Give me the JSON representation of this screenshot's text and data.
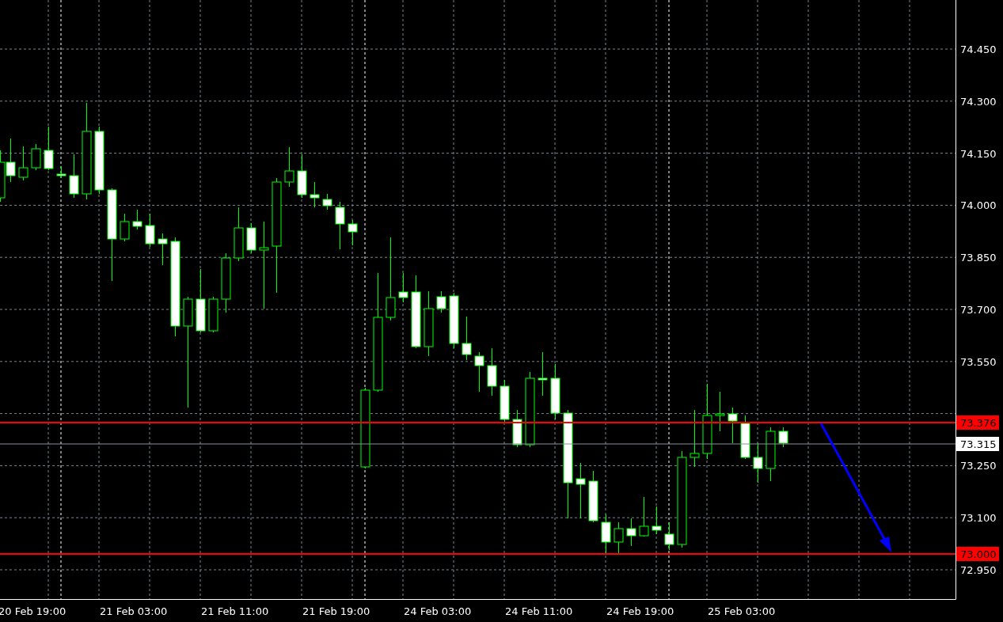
{
  "price_axis": {
    "ticks": [
      "74.450",
      "74.300",
      "74.150",
      "74.000",
      "73.850",
      "73.700",
      "73.550",
      "73.250",
      "73.100",
      "72.950"
    ]
  },
  "time_axis": {
    "ticks": [
      "20 Feb 19:00",
      "21 Feb 03:00",
      "21 Feb 11:00",
      "21 Feb 19:00",
      "24 Feb 03:00",
      "24 Feb 11:00",
      "24 Feb 19:00",
      "25 Feb 03:00"
    ]
  },
  "price_lines": [
    {
      "kind": "level",
      "label": "73.376"
    },
    {
      "kind": "bid",
      "label": "73.315"
    },
    {
      "kind": "level",
      "label": "73.000"
    }
  ]
}
